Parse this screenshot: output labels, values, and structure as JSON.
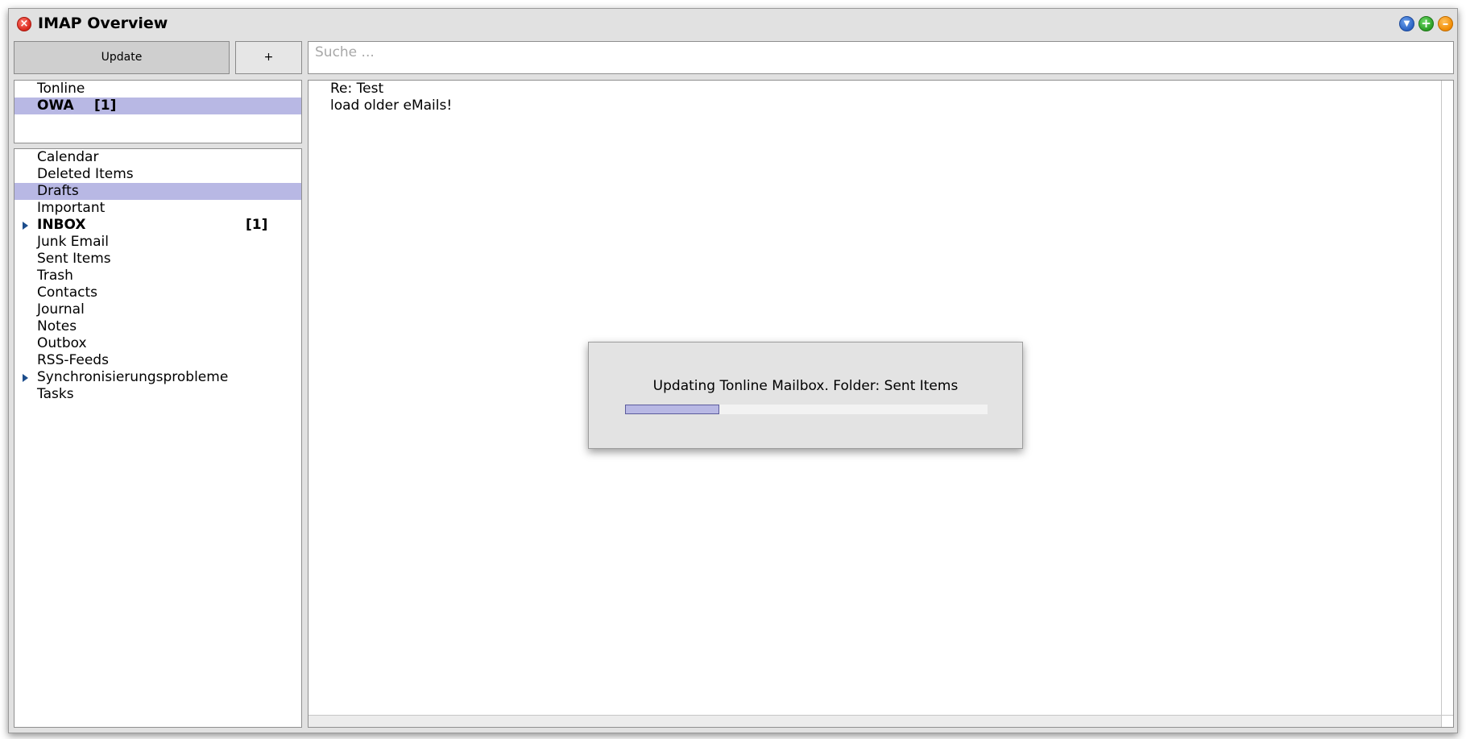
{
  "window": {
    "title": "IMAP Overview"
  },
  "toolbar": {
    "update_label": "Update",
    "add_label": "+"
  },
  "search": {
    "placeholder": "Suche ..."
  },
  "accounts": [
    {
      "name": "Tonline",
      "badge": "",
      "selected": false
    },
    {
      "name": "OWA",
      "badge": "[1]",
      "selected": true
    }
  ],
  "folders": [
    {
      "name": "Calendar"
    },
    {
      "name": "Deleted Items"
    },
    {
      "name": "Drafts",
      "selected": true
    },
    {
      "name": "Important"
    },
    {
      "name": "INBOX",
      "badge": "[1]",
      "bold": true,
      "expandable": true
    },
    {
      "name": "Junk Email"
    },
    {
      "name": "Sent Items"
    },
    {
      "name": "Trash"
    },
    {
      "name": "Contacts"
    },
    {
      "name": "Journal"
    },
    {
      "name": "Notes"
    },
    {
      "name": "Outbox"
    },
    {
      "name": "RSS-Feeds"
    },
    {
      "name": "Synchronisierungsprobleme",
      "expandable": true
    },
    {
      "name": "Tasks"
    }
  ],
  "messages": [
    {
      "subject": "Re: Test"
    },
    {
      "subject": "load older eMails!"
    }
  ],
  "progress_dialog": {
    "text": "Updating Tonline Mailbox. Folder: Sent Items",
    "progress": 0.26
  },
  "colors": {
    "selection": "#b8b8e4",
    "window_bg": "#e1e1e1",
    "close_button": "#d8271c",
    "add_button": "#2c9d25",
    "minimize_button": "#f08a00",
    "dropdown_button": "#2b62c2"
  }
}
